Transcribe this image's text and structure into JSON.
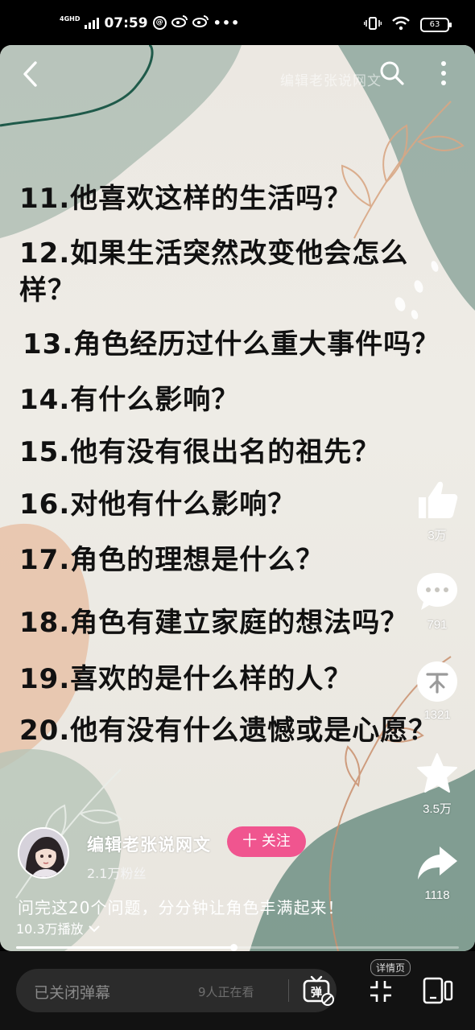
{
  "status_bar": {
    "network": "4GHD",
    "time": "07:59",
    "battery": "63"
  },
  "questions": [
    "11.他喜欢这样的生活吗？",
    "12.如果生活突然改变他会怎么",
    "样？",
    "13.角色经历过什么重大事件吗？",
    "14.有什么影响？",
    "15.他有没有很出名的祖先？",
    "16.对他有什么影响？",
    "17.角色的理想是什么？",
    "18.角色有建立家庭的想法吗？",
    "19.喜欢的是什么样的人？",
    "20.他有没有什么遗憾或是心愿？"
  ],
  "watermark": "编辑老张说网文",
  "actions": {
    "like_count": "3万",
    "comment_count": "791",
    "share_count_small": "1321",
    "favorite_count": "3.5万",
    "forward_count": "1118"
  },
  "author": {
    "name": "编辑老张说网文",
    "follow_label": "十 关注",
    "fans": "2.1万粉丝"
  },
  "description": "问完这20个问题，分分钟让角色丰满起来！",
  "plays": "10.3万播放",
  "progress": 0.49,
  "bottom_bar": {
    "danmaku_placeholder": "已关闭弹幕",
    "watching": "9人正在看",
    "danmaku_toggle_label": "弹",
    "detail_tag": "详情页"
  }
}
